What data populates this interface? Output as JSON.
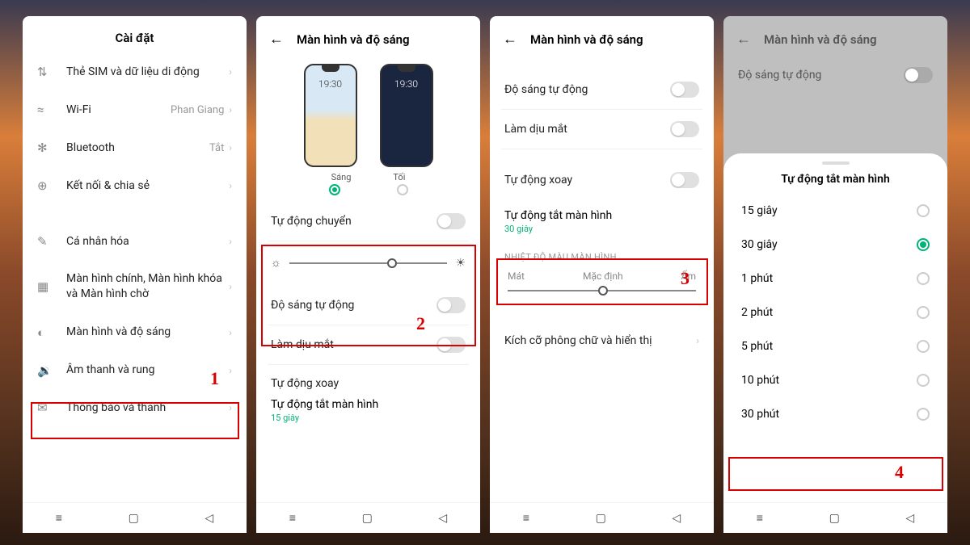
{
  "screen1": {
    "title": "Cài đặt",
    "items": [
      {
        "icon": "⇅",
        "label": "Thẻ SIM và dữ liệu di động",
        "value": "",
        "chev": true
      },
      {
        "icon": "≈",
        "label": "Wi-Fi",
        "value": "Phan Giang",
        "chev": true
      },
      {
        "icon": "✻",
        "label": "Bluetooth",
        "value": "Tắt",
        "chev": true
      },
      {
        "icon": "⊕",
        "label": "Kết nối & chia sẻ",
        "value": "",
        "chev": true
      },
      {
        "icon": "✎",
        "label": "Cá nhân hóa",
        "value": "",
        "chev": true
      },
      {
        "icon": "▦",
        "label": "Màn hình chính, Màn hình khóa và Màn hình chờ",
        "value": "",
        "chev": true
      },
      {
        "icon": "◐",
        "label": "Màn hình và độ sáng",
        "value": "",
        "chev": true
      },
      {
        "icon": "🔉",
        "label": "Âm thanh và rung",
        "value": "",
        "chev": true
      },
      {
        "icon": "✉",
        "label": "Thông báo và thanh",
        "value": "",
        "chev": true
      }
    ],
    "marker": "1"
  },
  "screen2": {
    "title": "Màn hình và độ sáng",
    "phone_time": "19:30",
    "mode_light": "Sáng",
    "mode_dark": "Tối",
    "auto_switch": "Tự động chuyển",
    "auto_brightness": "Độ sáng tự động",
    "eye_care": "Làm dịu mắt",
    "auto_rotate": "Tự động xoay",
    "screen_off": "Tự động tắt màn hình",
    "screen_off_val": "15 giây",
    "marker": "2"
  },
  "screen3": {
    "title": "Màn hình và độ sáng",
    "auto_brightness": "Độ sáng tự động",
    "eye_care": "Làm dịu mắt",
    "auto_rotate": "Tự động xoay",
    "screen_off": "Tự động tắt màn hình",
    "screen_off_val": "30 giây",
    "section": "NHIỆT ĐỘ MÀU MÀN HÌNH",
    "temp_cool": "Mát",
    "temp_default": "Mặc định",
    "temp_warm": "Ấm",
    "font_size": "Kích cỡ phông chữ và hiển thị",
    "marker": "3"
  },
  "screen4": {
    "title": "Màn hình và độ sáng",
    "auto_brightness": "Độ sáng tự động",
    "sheet_title": "Tự động tắt màn hình",
    "options": [
      "15 giây",
      "30 giây",
      "1 phút",
      "2 phút",
      "5 phút",
      "10 phút",
      "30 phút"
    ],
    "selected": "30 giây",
    "marker": "4"
  }
}
